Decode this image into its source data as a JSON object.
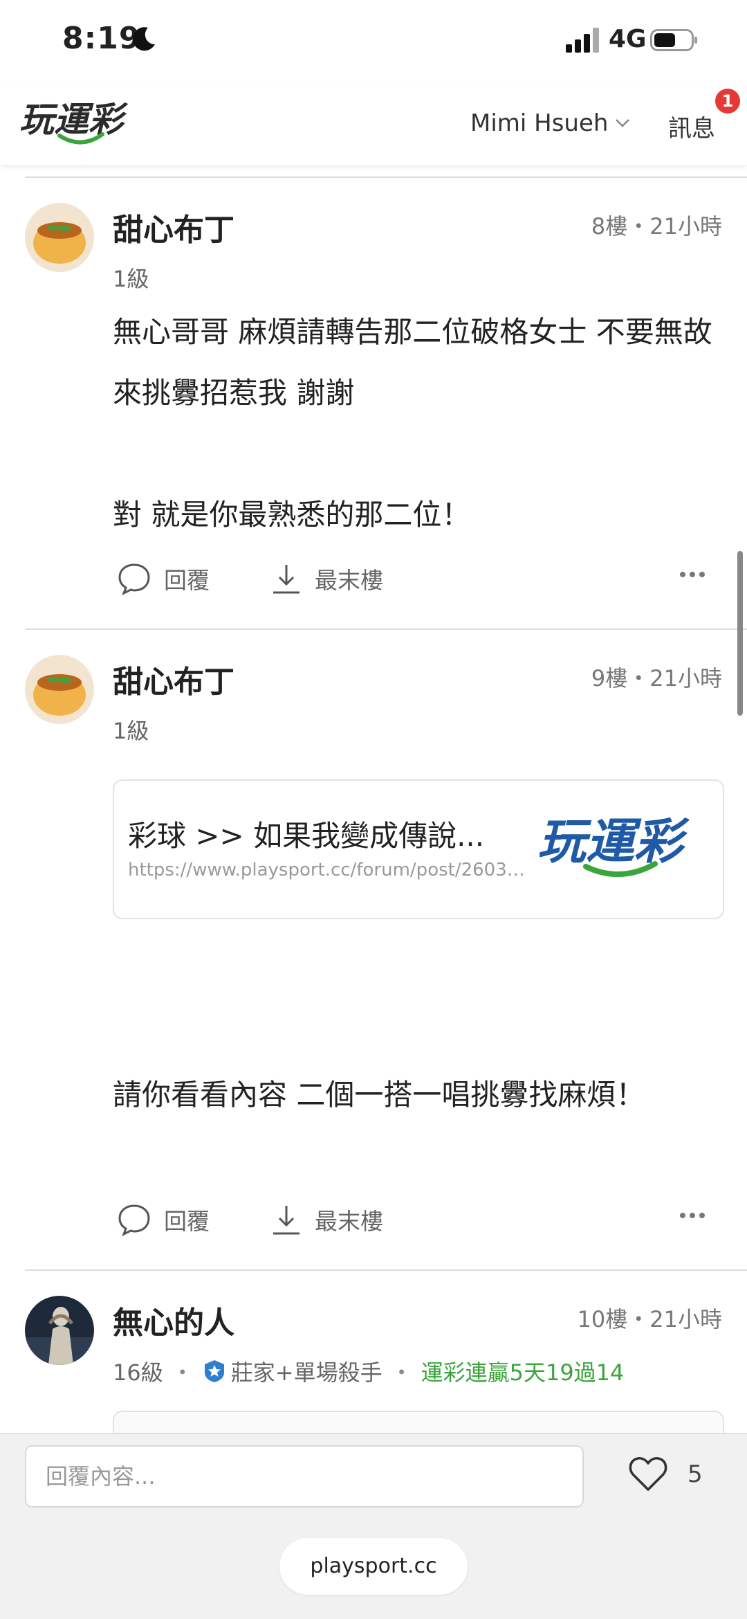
{
  "status_bar": {
    "time": "8:19",
    "network": "4G"
  },
  "header": {
    "logo_text": "玩運彩",
    "user_name": "Mimi Hsueh",
    "messages_label": "訊息",
    "messages_badge": "1"
  },
  "posts": [
    {
      "author": "甜心布丁",
      "meta": "8樓・21小時",
      "level": "1級",
      "body": "無心哥哥 麻煩請轉告那二位破格女士 不要無故來挑釁招惹我 謝謝\n\n對 就是你最熟悉的那二位！",
      "reply_label": "回覆",
      "last_floor_label": "最末樓"
    },
    {
      "author": "甜心布丁",
      "meta": "9樓・21小時",
      "level": "1級",
      "link_card": {
        "title": "彩球 >> 如果我變成傳說...",
        "url": "https://www.playsport.cc/forum/post/2603212...",
        "logo_text": "玩運彩"
      },
      "body": "請你看看內容 二個一搭一唱挑釁找麻煩！",
      "reply_label": "回覆",
      "last_floor_label": "最末樓"
    },
    {
      "author": "無心的人",
      "meta": "10樓・21小時",
      "level": "16級",
      "badge_title": "莊家+單場殺手",
      "streak": "運彩連贏5天19過14"
    }
  ],
  "reply_bar": {
    "placeholder": "回覆內容...",
    "like_count": "5"
  },
  "browser": {
    "domain": "playsport.cc"
  },
  "colors": {
    "accent_green": "#3aa53a",
    "badge_red": "#e53935",
    "logo_blue": "#1f5aa6"
  }
}
